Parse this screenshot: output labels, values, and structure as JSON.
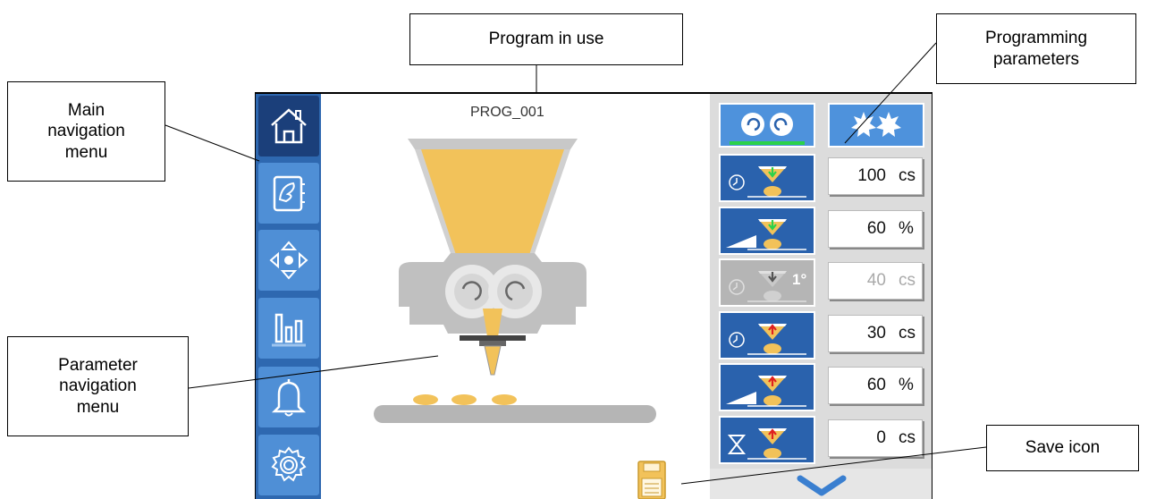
{
  "callouts": {
    "program_in_use": "Program in use",
    "programming_parameters": "Programming\nparameters",
    "main_navigation_menu": "Main\nnavigation\nmenu",
    "parameter_navigation_menu": "Parameter\nnavigation\nmenu",
    "save_icon": "Save icon"
  },
  "screen": {
    "program_name": "PROG_001"
  },
  "nav": {
    "items": [
      {
        "icon": "home-icon",
        "active": true
      },
      {
        "icon": "recipe-book-icon",
        "active": false
      },
      {
        "icon": "directional-pad-icon",
        "active": false
      },
      {
        "icon": "bar-chart-icon",
        "active": false
      },
      {
        "icon": "bell-icon",
        "active": false
      },
      {
        "icon": "gear-icon",
        "active": false
      }
    ]
  },
  "parameters": {
    "mode_buttons": [
      "twin-gear-mode-icon",
      "star-gear-mode-icon"
    ],
    "rows": [
      {
        "icon": "timed-close-dosing-icon",
        "value": "100",
        "unit": "cs",
        "enabled": true
      },
      {
        "icon": "ramp-close-dosing-icon",
        "value": "60",
        "unit": "%",
        "enabled": true
      },
      {
        "icon": "timed-first-dosing-icon",
        "label": "1°",
        "value": "40",
        "unit": "cs",
        "enabled": false
      },
      {
        "icon": "timed-open-dosing-icon",
        "value": "30",
        "unit": "cs",
        "enabled": true
      },
      {
        "icon": "ramp-open-dosing-icon",
        "value": "60",
        "unit": "%",
        "enabled": true
      },
      {
        "icon": "hourglass-dosing-icon",
        "value": "0",
        "unit": "cs",
        "enabled": true
      }
    ]
  },
  "colors": {
    "nav_background": "#2e68b0",
    "nav_button": "#4f8fd6",
    "nav_active": "#1b3f7a",
    "param_button": "#2a62ad",
    "product": "#f2c25a",
    "machine_gray": "#c8c8c8"
  }
}
